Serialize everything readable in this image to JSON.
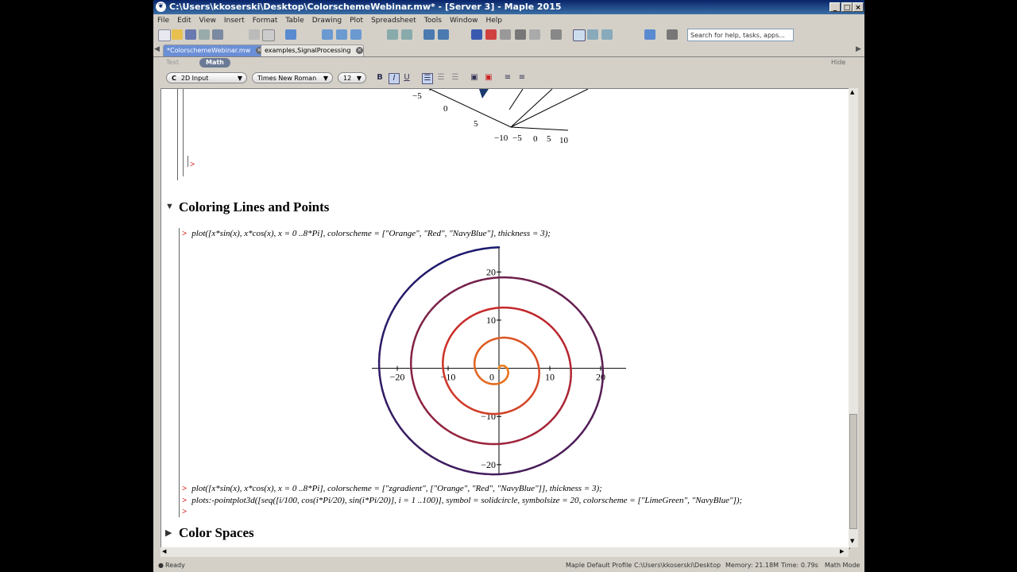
{
  "window": {
    "title": "C:\\Users\\kkoserski\\Desktop\\ColorschemeWebinar.mw* - [Server 3] - Maple 2015",
    "minimize": "_",
    "maximize": "□",
    "close": "×"
  },
  "menu": [
    "File",
    "Edit",
    "View",
    "Insert",
    "Format",
    "Table",
    "Drawing",
    "Plot",
    "Spreadsheet",
    "Tools",
    "Window",
    "Help"
  ],
  "search": {
    "placeholder": "Search for help, tasks, apps..."
  },
  "tabs": [
    {
      "label": "*ColorschemeWebinar.mw",
      "active": true
    },
    {
      "label": "examples,SignalProcessing",
      "active": false
    }
  ],
  "mode": {
    "text": "Text",
    "math": "Math",
    "hide": "Hide"
  },
  "format": {
    "input_mode": "2D Input",
    "input_mode_prefix": "C",
    "font": "Times New Roman",
    "size": "12",
    "bold": "B",
    "italic": "I",
    "underline": "U"
  },
  "document": {
    "prev_plot_ticks": {
      "y_left": "−5",
      "y_zero": "0",
      "y_five": "5",
      "x_ticks": [
        "−10",
        "−5",
        "0",
        "5",
        "10"
      ]
    },
    "section1_title": "Coloring Lines and Points",
    "cmd1": "plot([x*sin(x), x*cos(x), x = 0 ..8*Pi], colorscheme = [\"Orange\", \"Red\", \"NavyBlue\"], thickness = 3);",
    "plot_x_ticks": [
      "−20",
      "−10",
      "0",
      "10",
      "20"
    ],
    "plot_y_ticks": [
      "20",
      "10",
      "−10",
      "−20"
    ],
    "cmd2": "plot([x*sin(x), x*cos(x), x = 0 ..8*Pi], colorscheme = [\"zgradient\", [\"Orange\", \"Red\", \"NavyBlue\"]], thickness = 3);",
    "cmd3": "plots:-pointplot3d([seq([i/100, cos(i*Pi/20), sin(i*Pi/20)], i = 1 ..100)], symbol = solidcircle, symbolsize = 20, colorscheme = [\"LimeGreen\", \"NavyBlue\"]);",
    "prompt_symbol": ">",
    "section2_title": "Color Spaces"
  },
  "chart_data": {
    "type": "line",
    "function": "spiral x*sin(x), x*cos(x), x = 0..8*Pi",
    "colorscheme": [
      "Orange",
      "Red",
      "NavyBlue"
    ],
    "thickness": 3,
    "xlim": [
      -25,
      25
    ],
    "ylim": [
      -22,
      25
    ],
    "colors": {
      "orange": "#f08a1e",
      "red": "#c8282a",
      "navy": "#1a1a6e"
    }
  },
  "status": {
    "state": "Ready",
    "profile": "Maple Default Profile",
    "path": "C:\\Users\\kkoserski\\Desktop",
    "memory": "Memory: 21.18M",
    "time": "Time: 0.79s",
    "mode": "Math Mode"
  }
}
